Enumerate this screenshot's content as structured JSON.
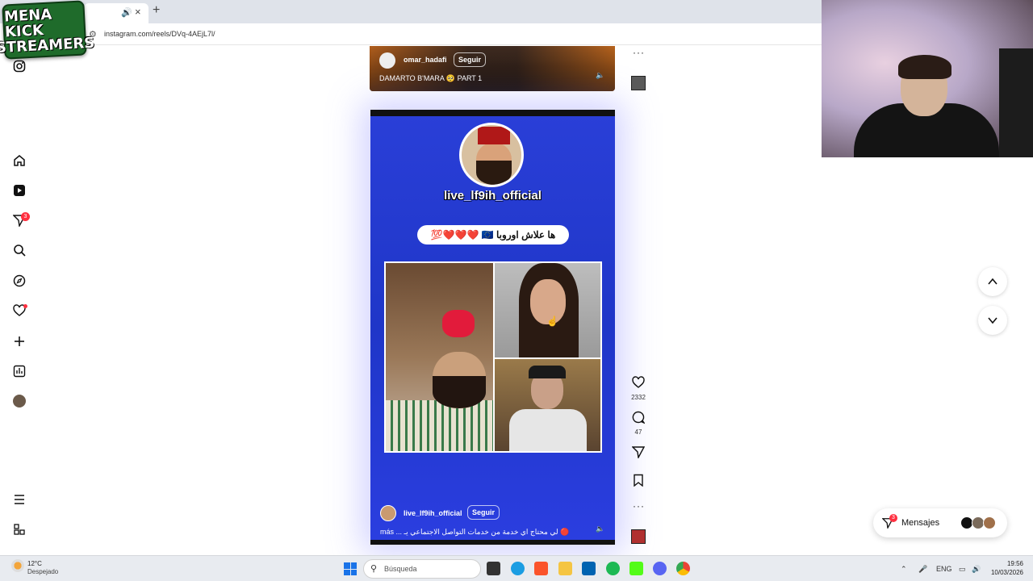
{
  "browser": {
    "url": "instagram.com/reels/DVq-4AEjL7l/"
  },
  "overlay": {
    "logo_line1": "MENA KICK",
    "logo_line2": "STREAMERS"
  },
  "sidebar": {
    "icons": [
      "instagram-icon",
      "home-icon",
      "reels-icon",
      "direct-icon",
      "search-icon",
      "explore-icon",
      "heart-icon",
      "create-icon",
      "dashboard-icon",
      "profile-avatar",
      "menu-icon",
      "meta-icon"
    ],
    "direct_badge": "3"
  },
  "reel_top": {
    "username": "omar_hadafi",
    "follow_label": "Seguir",
    "caption": "DAMARTO B'MARA 🥺 PART 1"
  },
  "reel_main": {
    "handle": "live_lf9ih_official",
    "banner": "ها علاش اوروبا 🇪🇺 ❤️❤️❤️💯",
    "username": "live_lf9ih_official",
    "follow_label": "Seguir",
    "caption": "más ... لي محتاج اي خدمة من خدمات التواصل الاجتماعي يـ 🔴"
  },
  "actions": {
    "likes": "2332",
    "comments": "47"
  },
  "messages": {
    "label": "Mensajes",
    "badge": "3"
  },
  "taskbar": {
    "temp": "12°C",
    "weather": "Despejado",
    "search_placeholder": "Búsqueda",
    "lang": "ENG",
    "time": "19:56",
    "date": "10/03/2026"
  },
  "colors": {
    "reel_bg": "#2a3fd8",
    "badge": "#ff3040",
    "logo_green": "#1f6b2b"
  }
}
